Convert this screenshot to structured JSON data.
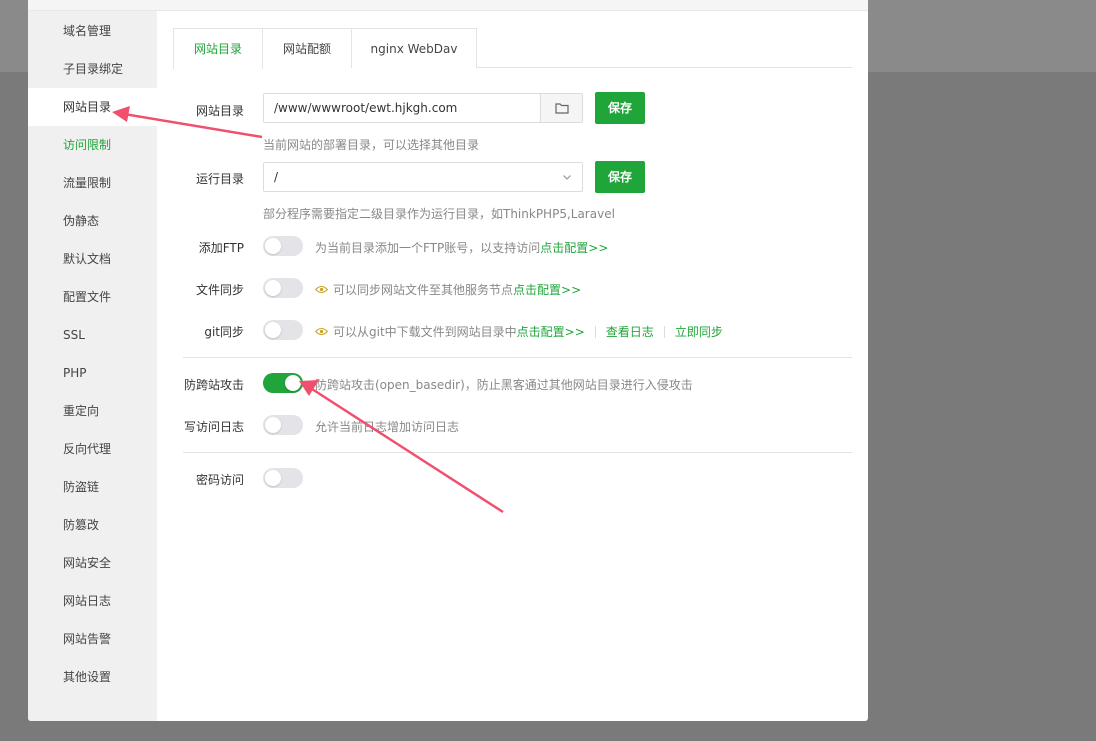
{
  "sidebar": {
    "items": [
      {
        "label": "域名管理"
      },
      {
        "label": "子目录绑定"
      },
      {
        "label": "网站目录"
      },
      {
        "label": "访问限制"
      },
      {
        "label": "流量限制"
      },
      {
        "label": "伪静态"
      },
      {
        "label": "默认文档"
      },
      {
        "label": "配置文件"
      },
      {
        "label": "SSL"
      },
      {
        "label": "PHP"
      },
      {
        "label": "重定向"
      },
      {
        "label": "反向代理"
      },
      {
        "label": "防盗链"
      },
      {
        "label": "防篡改"
      },
      {
        "label": "网站安全"
      },
      {
        "label": "网站日志"
      },
      {
        "label": "网站告警"
      },
      {
        "label": "其他设置"
      }
    ],
    "selected": "网站目录",
    "highlight_color": "#20a53a"
  },
  "tabs": [
    {
      "label": "网站目录"
    },
    {
      "label": "网站配额"
    },
    {
      "label": "nginx WebDav"
    }
  ],
  "form": {
    "site_dir": {
      "label": "网站目录",
      "value": "/www/wwwroot/ewt.hjkgh.com",
      "save_label": "保存",
      "hint": "当前网站的部署目录，可以选择其他目录"
    },
    "run_dir": {
      "label": "运行目录",
      "value": "/",
      "save_label": "保存",
      "hint": "部分程序需要指定二级目录作为运行目录，如ThinkPHP5,Laravel"
    },
    "add_ftp": {
      "label": "添加FTP",
      "enabled": false,
      "desc": "为当前目录添加一个FTP账号，以支持访问",
      "link": "点击配置>>"
    },
    "file_sync": {
      "label": "文件同步",
      "enabled": false,
      "desc": "可以同步网站文件至其他服务节点",
      "link": "点击配置>>"
    },
    "git_sync": {
      "label": "git同步",
      "enabled": false,
      "desc": "可以从git中下载文件到网站目录中",
      "link": "点击配置>>",
      "log_link": "查看日志",
      "sync_link": "立即同步"
    },
    "anti_xss": {
      "label": "防跨站攻击",
      "enabled": true,
      "desc": "防跨站攻击(open_basedir)，防止黑客通过其他网站目录进行入侵攻击"
    },
    "access_log": {
      "label": "写访问日志",
      "enabled": false,
      "desc": "允许当前日志增加访问日志"
    },
    "password_access": {
      "label": "密码访问",
      "enabled": false
    }
  },
  "colors": {
    "accent": "#20a53a",
    "annotation_arrow": "#f0506e"
  }
}
